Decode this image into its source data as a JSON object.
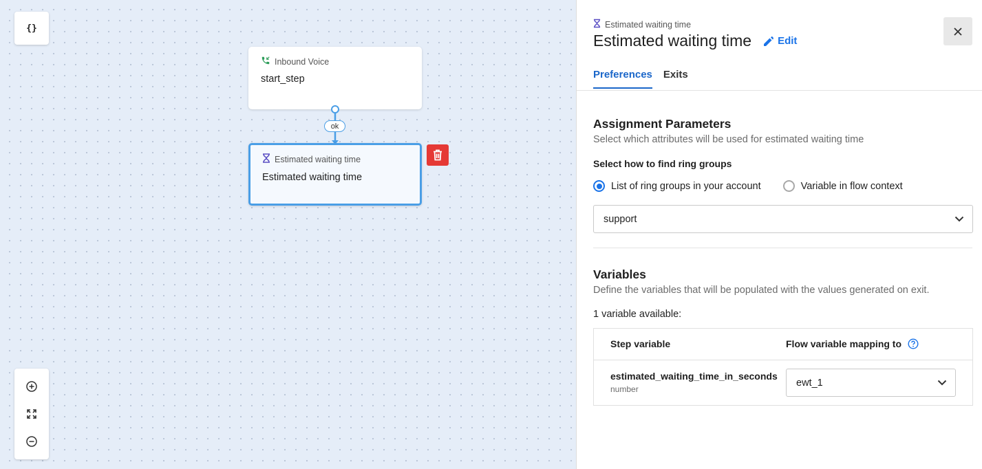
{
  "canvas": {
    "json_button_label": "{}",
    "nodes": {
      "start": {
        "type_label": "Inbound Voice",
        "name": "start_step"
      },
      "ewt": {
        "type_label": "Estimated waiting time",
        "name": "Estimated waiting time"
      }
    },
    "connector_label": "ok",
    "zoom": {
      "in_icon": "zoom-in-icon",
      "fit_icon": "fit-screen-icon",
      "out_icon": "zoom-out-icon"
    }
  },
  "panel": {
    "pre_title": "Estimated waiting time",
    "title": "Estimated waiting time",
    "edit_label": "Edit",
    "tabs": [
      {
        "label": "Preferences",
        "active": true
      },
      {
        "label": "Exits",
        "active": false
      }
    ],
    "assignment": {
      "heading": "Assignment Parameters",
      "description": "Select which attributes will be used for estimated waiting time",
      "find_label": "Select how to find ring groups",
      "radio_options": [
        {
          "label": "List of ring groups in your account",
          "selected": true
        },
        {
          "label": "Variable in flow context",
          "selected": false
        }
      ],
      "ring_group_value": "support"
    },
    "variables": {
      "heading": "Variables",
      "description": "Define the variables that will be populated with the values generated on exit.",
      "count_text": "1 variable available:",
      "columns": [
        "Step variable",
        "Flow variable mapping to"
      ],
      "rows": [
        {
          "name": "estimated_waiting_time_in_seconds",
          "type": "number",
          "mapping": "ewt_1"
        }
      ]
    }
  },
  "colors": {
    "accent": "#1a73e8",
    "danger": "#e53935",
    "node_border": "#4a9ee6",
    "canvas_bg": "#e5edf8"
  }
}
